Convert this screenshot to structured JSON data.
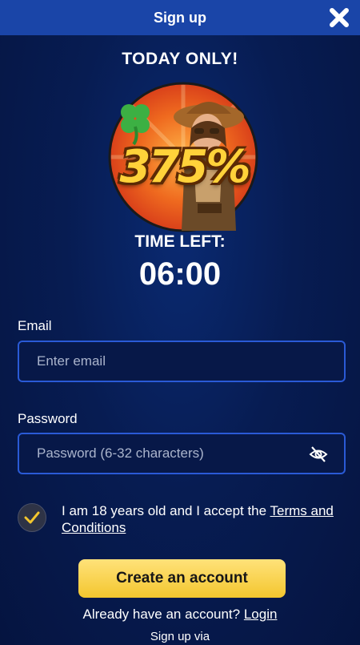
{
  "header": {
    "title": "Sign up",
    "close_icon": "close-icon"
  },
  "promo": {
    "title": "TODAY ONLY!",
    "bonus": "375%",
    "time_label": "TIME LEFT:",
    "timer": "06:00",
    "colors": {
      "badge_orange": "#e8521d",
      "bonus_yellow": "#ffd23a",
      "clover_green": "#3cb043"
    }
  },
  "form": {
    "email_label": "Email",
    "email_placeholder": "Enter email",
    "password_label": "Password",
    "password_placeholder": "Password (6-32 characters)",
    "password_toggle_icon": "eye-off-icon",
    "terms_prefix": "I am 18 years old and I accept the ",
    "terms_link": "Terms and Conditions",
    "terms_checked": true,
    "submit_label": "Create an account"
  },
  "footer": {
    "login_prefix": "Already have an account? ",
    "login_link": "Login",
    "signup_via": "Sign up via"
  },
  "colors": {
    "background": "#071c52",
    "header": "#1a45a8",
    "input_border": "#2a5ad6",
    "cta": "#f3c62e",
    "check": "#f3c62e"
  }
}
